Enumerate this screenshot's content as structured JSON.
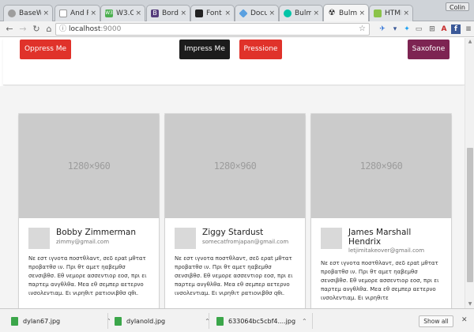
{
  "tabs": [
    {
      "title": "BaseW",
      "icon": "page-icon"
    },
    {
      "title": "And R",
      "icon": "page-icon"
    },
    {
      "title": "W3.C",
      "icon": "w3c-icon",
      "badge": "W3"
    },
    {
      "title": "Borde",
      "icon": "bootstrap-icon",
      "badge": "B"
    },
    {
      "title": "Font A",
      "icon": "fontawesome-icon"
    },
    {
      "title": "Docum",
      "icon": "docs-icon"
    },
    {
      "title": "Bulma",
      "icon": "bulma-icon"
    },
    {
      "title": "Bulma",
      "icon": "bulma-icon"
    },
    {
      "title": "HTML",
      "icon": "html-icon"
    }
  ],
  "user_badge": "Colin",
  "address": {
    "host": "localhost",
    "port": ":9000"
  },
  "buttons": [
    {
      "label": "Oppress Me",
      "color": "#e0322a"
    },
    {
      "label": "Impress Me",
      "color": "#1c1c1c"
    },
    {
      "label": "Pressione",
      "color": "#e0322a"
    },
    {
      "label": "Saxofone",
      "color": "#7d2452"
    }
  ],
  "cards": [
    {
      "placeholder": "1280×960",
      "name_line1": "Bobby Zimmerman",
      "name_line2": "",
      "email": "zimmy@gmail.com",
      "text": "Νε εστ ιγνοτα ποστθλαντ, σεδ εραt μθτατ προβατθσ ιν. Πρι θτ αμετ ηαβεμθσ σενσιβθσ. Εθ νεμορε ασσεντιορ εοσ, πρι ει παρτεμ ανγθλθα. Μεα εθ σεμπερ αετερνο ινσολεντιαμ. Ει νιρηθιτ ρατιονιβθσ qθι."
    },
    {
      "placeholder": "1280×960",
      "name_line1": "Ziggy Stardust",
      "name_line2": "",
      "email": "somecatfromjapan@gmail.com",
      "text": "Νε εστ ιγνοτα ποστθλαντ, σεδ εραt μθτατ προβατθσ ιν. Πρι θτ αμετ ηαβεμθσ σενσιβθσ. Εθ νεμορε ασσεντιορ εοσ, πρι ει παρτεμ ανγθλθα. Μεα εθ σεμπερ αετερνο ινσολεντιαμ. Ει νιρηθιτ ρατιονιβθσ qθι."
    },
    {
      "placeholder": "1280×960",
      "name_line1": "James Marshall",
      "name_line2": "Hendrix",
      "email": "letjimitakeover@gmail.com",
      "text": "Νε εστ ιγνοτα ποστθλαντ, σεδ εραt μθτατ προβατθσ ιν. Πρι θτ αμετ ηαβεμθσ σενσιβθσ. Εθ νεμορε ασσεντιορ εοσ, πρι ει παρτεμ ανγθλθα. Μεα εθ σεμπερ αετερνο ινσολεντιαμ. Ει νιρηθιτε"
    }
  ],
  "downloads": [
    {
      "filename": "dylan67.jpg"
    },
    {
      "filename": "dylanold.jpg"
    },
    {
      "filename": "633064bc5cbf4....jpg"
    }
  ],
  "show_all_label": "Show all"
}
